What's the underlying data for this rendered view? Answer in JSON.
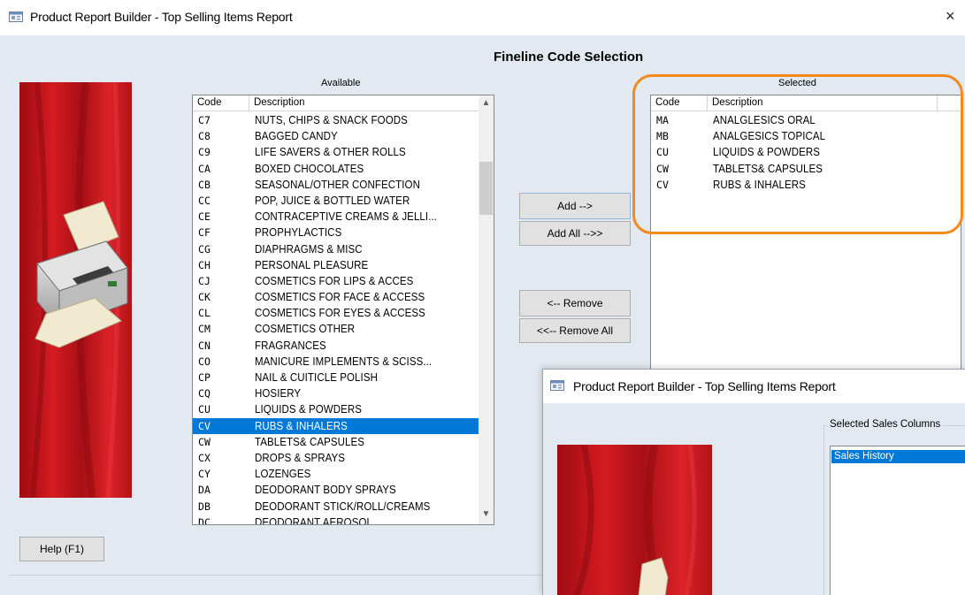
{
  "window": {
    "title": "Product Report Builder - Top Selling Items Report",
    "close_glyph": "×"
  },
  "heading": "Fineline Code Selection",
  "available": {
    "label": "Available",
    "col_code": "Code",
    "col_description": "Description",
    "selected_index": 20,
    "rows": [
      {
        "code": "C7",
        "description": "NUTS, CHIPS & SNACK FOODS"
      },
      {
        "code": "C8",
        "description": "BAGGED CANDY"
      },
      {
        "code": "C9",
        "description": "LIFE SAVERS & OTHER ROLLS"
      },
      {
        "code": "CA",
        "description": "BOXED CHOCOLATES"
      },
      {
        "code": "CB",
        "description": "SEASONAL/OTHER CONFECTION"
      },
      {
        "code": "CC",
        "description": "POP, JUICE & BOTTLED WATER"
      },
      {
        "code": "CE",
        "description": "CONTRACEPTIVE CREAMS & JELLI..."
      },
      {
        "code": "CF",
        "description": "PROPHYLACTICS"
      },
      {
        "code": "CG",
        "description": "DIAPHRAGMS & MISC"
      },
      {
        "code": "CH",
        "description": "PERSONAL PLEASURE"
      },
      {
        "code": "CJ",
        "description": "COSMETICS FOR LIPS & ACCES"
      },
      {
        "code": "CK",
        "description": "COSMETICS FOR FACE & ACCESS"
      },
      {
        "code": "CL",
        "description": "COSMETICS FOR EYES & ACCESS"
      },
      {
        "code": "CM",
        "description": "COSMETICS OTHER"
      },
      {
        "code": "CN",
        "description": "FRAGRANCES"
      },
      {
        "code": "CO",
        "description": "MANICURE IMPLEMENTS & SCISS..."
      },
      {
        "code": "CP",
        "description": "NAIL & CUITICLE POLISH"
      },
      {
        "code": "CQ",
        "description": "HOSIERY"
      },
      {
        "code": "CU",
        "description": "LIQUIDS & POWDERS"
      },
      {
        "code": "CV",
        "description": "RUBS & INHALERS"
      },
      {
        "code": "CW",
        "description": "TABLETS& CAPSULES"
      },
      {
        "code": "CX",
        "description": "DROPS & SPRAYS"
      },
      {
        "code": "CY",
        "description": "LOZENGES"
      },
      {
        "code": "DA",
        "description": "DEODORANT BODY SPRAYS"
      },
      {
        "code": "DB",
        "description": "DEODORANT STICK/ROLL/CREAMS"
      },
      {
        "code": "DC",
        "description": "DEODORANT AEROSOL"
      }
    ]
  },
  "selected": {
    "label": "Selected",
    "col_code": "Code",
    "col_description": "Description",
    "rows": [
      {
        "code": "MA",
        "description": "ANALGLESICS ORAL"
      },
      {
        "code": "MB",
        "description": "ANALGESICS TOPICAL"
      },
      {
        "code": "CU",
        "description": "LIQUIDS & POWDERS"
      },
      {
        "code": "CW",
        "description": "TABLETS& CAPSULES"
      },
      {
        "code": "CV",
        "description": "RUBS & INHALERS"
      }
    ]
  },
  "buttons": {
    "add": "Add -->",
    "add_all": "Add All -->>",
    "remove": "<-- Remove",
    "remove_all": "<<-- Remove All",
    "help": "Help (F1)"
  },
  "overlay": {
    "title": "Product Report Builder - Top Selling Items Report",
    "group_label": "Selected Sales Columns",
    "items": [
      "Sales History"
    ]
  },
  "colors": {
    "window_bg": "#e3e9f0",
    "selection": "#0078d7",
    "highlight_ring": "#f28a1e",
    "banner_red": "#c8141c"
  },
  "icons": {
    "app_icon": "window-app-icon",
    "printer": "printer-icon",
    "scroll_up": "scroll-up-arrow-icon",
    "scroll_down": "scroll-down-arrow-icon"
  }
}
